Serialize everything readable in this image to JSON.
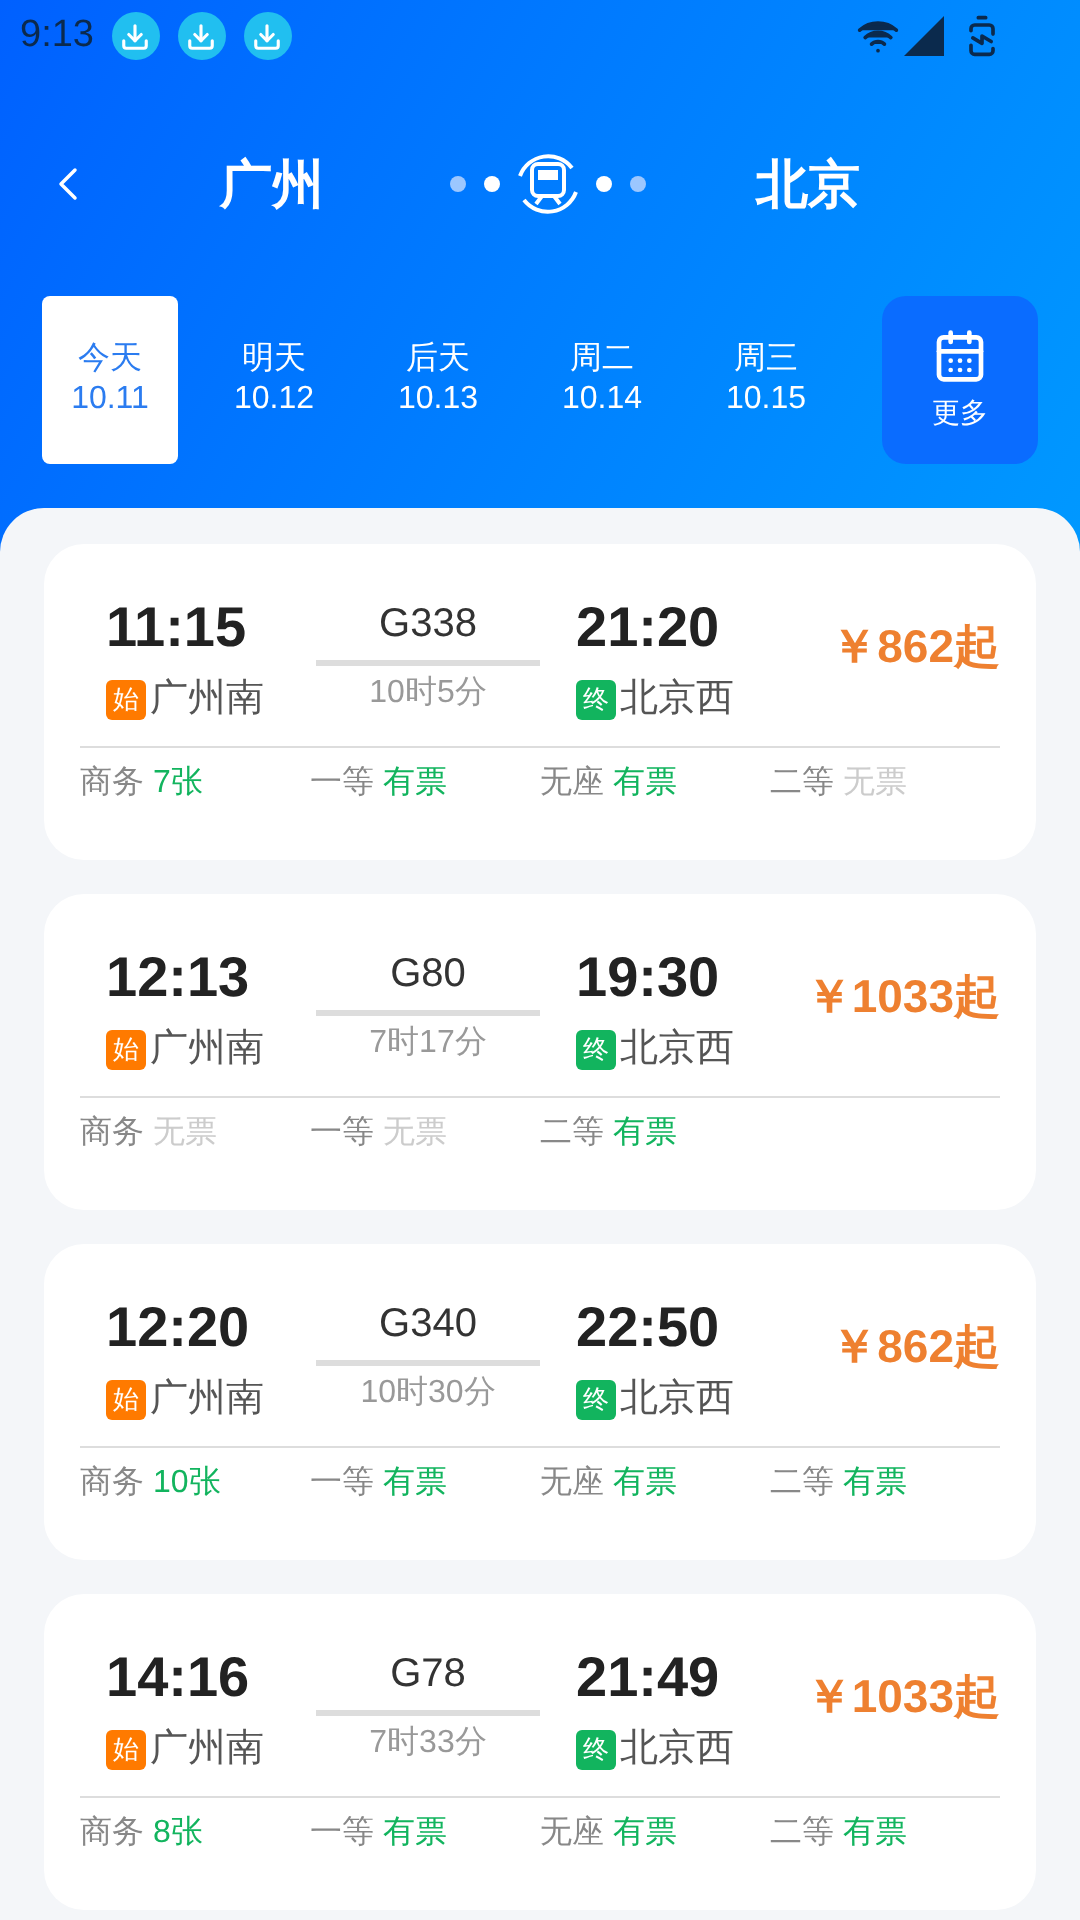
{
  "status_bar": {
    "time": "9:13"
  },
  "header": {
    "from": "广州",
    "to": "北京"
  },
  "date_tabs": [
    {
      "day": "今天",
      "date": "10.11",
      "selected": true
    },
    {
      "day": "明天",
      "date": "10.12",
      "selected": false
    },
    {
      "day": "后天",
      "date": "10.13",
      "selected": false
    },
    {
      "day": "周二",
      "date": "10.14",
      "selected": false
    },
    {
      "day": "周三",
      "date": "10.15",
      "selected": false
    }
  ],
  "more_button": {
    "label": "更多"
  },
  "trains": [
    {
      "depart": "11:15",
      "train": "G338",
      "arrive": "21:20",
      "price": "￥862起",
      "from_tag": "始",
      "from_station": "广州南",
      "duration": "10时5分",
      "to_tag": "终",
      "to_station": "北京西",
      "seats": [
        {
          "class": "商务",
          "status": "7张",
          "available": true
        },
        {
          "class": "一等",
          "status": "有票",
          "available": true
        },
        {
          "class": "无座",
          "status": "有票",
          "available": true
        },
        {
          "class": "二等",
          "status": "无票",
          "available": false
        }
      ]
    },
    {
      "depart": "12:13",
      "train": "G80",
      "arrive": "19:30",
      "price": "￥1033起",
      "from_tag": "始",
      "from_station": "广州南",
      "duration": "7时17分",
      "to_tag": "终",
      "to_station": "北京西",
      "seats": [
        {
          "class": "商务",
          "status": "无票",
          "available": false
        },
        {
          "class": "一等",
          "status": "无票",
          "available": false
        },
        {
          "class": "二等",
          "status": "有票",
          "available": true
        }
      ]
    },
    {
      "depart": "12:20",
      "train": "G340",
      "arrive": "22:50",
      "price": "￥862起",
      "from_tag": "始",
      "from_station": "广州南",
      "duration": "10时30分",
      "to_tag": "终",
      "to_station": "北京西",
      "seats": [
        {
          "class": "商务",
          "status": "10张",
          "available": true
        },
        {
          "class": "一等",
          "status": "有票",
          "available": true
        },
        {
          "class": "无座",
          "status": "有票",
          "available": true
        },
        {
          "class": "二等",
          "status": "有票",
          "available": true
        }
      ]
    },
    {
      "depart": "14:16",
      "train": "G78",
      "arrive": "21:49",
      "price": "￥1033起",
      "from_tag": "始",
      "from_station": "广州南",
      "duration": "7时33分",
      "to_tag": "终",
      "to_station": "北京西",
      "seats": [
        {
          "class": "商务",
          "status": "8张",
          "available": true
        },
        {
          "class": "一等",
          "status": "有票",
          "available": true
        },
        {
          "class": "无座",
          "status": "有票",
          "available": true
        },
        {
          "class": "二等",
          "status": "有票",
          "available": true
        }
      ]
    }
  ]
}
